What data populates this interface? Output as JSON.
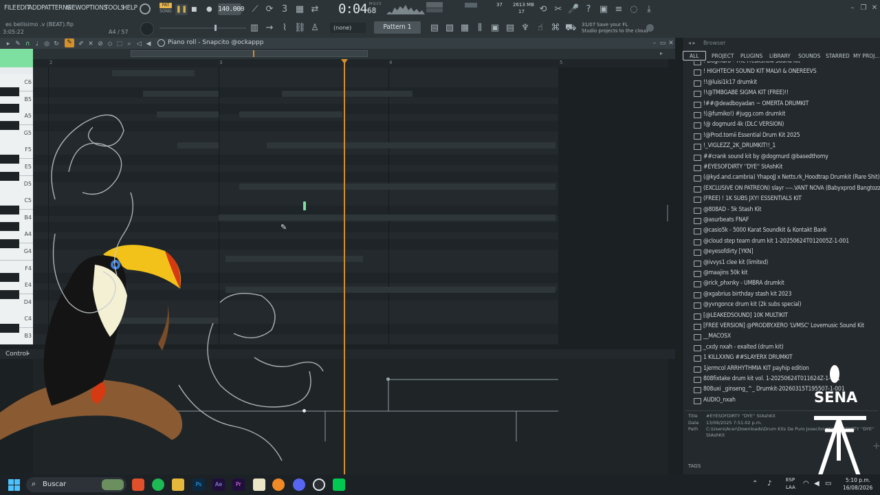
{
  "menu": [
    "FILE",
    "EDIT",
    "ADD",
    "PATTERNS",
    "VIEW",
    "OPTIONS",
    "TOOLS",
    "HELP"
  ],
  "transport": {
    "pat_label": "PAT",
    "song_label": "SONG",
    "tempo": "140.000",
    "time": "0:04",
    "time_small": "68",
    "time_unit": "M:S:CS",
    "cpu": "37",
    "mem": "2613 MB",
    "voices": "17"
  },
  "project": {
    "file": "es bellisimo .v (BEAT).flp",
    "position": "3:05:22",
    "note": "A4 / 57"
  },
  "toolbar": {
    "snap": "(none)",
    "pattern": "Pattern 1",
    "news_date": "31/07",
    "news_line1": "Save your FL",
    "news_line2": "Studio projects to the cloud"
  },
  "pianoroll": {
    "title": "Piano roll - Snapcito @ockappp",
    "bars": [
      "2",
      "3",
      "4",
      "5"
    ],
    "keys": [
      "C6",
      "B5",
      "A5",
      "G5",
      "F5",
      "E5",
      "D5",
      "C5",
      "B4",
      "A4",
      "G4",
      "F4",
      "E4",
      "D4",
      "C4",
      "B3"
    ],
    "control_label": "Control"
  },
  "browser": {
    "title": "Browser",
    "tabs": [
      "ALL",
      "PROJECT",
      "PLUGINS",
      "LIBRARY",
      "SOUNDS",
      "STARRED",
      "MY PROJ..."
    ],
    "items": [
      "! Dogmuro - The Freakshow Sound Kit",
      "! HIGHTECH SOUND KIT MALVI & ONEREEVS",
      "!!@luisi1k17 drumkit",
      "!!@TMBGABE SIGMA KIT (FREE)!!",
      "!##@deadboyadan ~ OMERTA DRUMKIT",
      "!(@fumiko!) #jugg.com drumkit",
      "!@ dogmurd 4k (DLC VERSION)",
      "!@Prod.tomii Essential Drum Kit 2025",
      "!_VIGLEZZ_2K_DRUMKIT!!_1",
      "##crank sound kit by @dogmurd @basedthomy",
      "#EYESOFDIRTY ''DYE'' StAshKit",
      "(@kyd.and.cambria) YhapoJJ x Netts.rk_Hoodtrap Drumkit (Rare Shit)",
      "(EXCLUSIVE ON PATREON) slayr ----.VANT NOVA (Babyxprod Bangtozzy)",
      "(FREE) ! 1K SUBS JXY! ESSENTIALS KIT",
      "@808AD - 5k Stash Kit",
      "@asurbeats FNAF",
      "@casio5k - 5000 Karat Soundkit & Kontakt Bank",
      "@cloud step team drum kit 1-20250624T012005Z-1-001",
      "@eyesofdirty [YKN]",
      "@ivvys1 clee kit (limited)",
      "@maajins 50k kit",
      "@rick_phxnky - UMBRA drumkit",
      "@xgabrius birthday stash kit 2023",
      "@yvngonce drum kit (2k subs special)",
      "[@LEAKEDSOUND] 10K MULTIKIT",
      "[FREE VERSION] @PRODBY.XERO 'LVMSC' Lovemusic Sound Kit",
      "__MACOSX",
      "_cxdy nxah - exalted (drum kit)",
      "1 KILLXXNG ##SLAYERX DRUMKIT",
      "1jermcol ARRHYTHMIA KIT payhip edition",
      "808fixtake drum kit vol. 1-20250624T011624Z-1-001",
      "808uxi _ginseng_^_ Drumkit-20260315T195507-1-001",
      "AUDIO_nxah"
    ],
    "info": {
      "title_label": "Title",
      "title": "#EYESOFDIRTY ''DYE'' StAshKit",
      "date_label": "Date",
      "date": "13/09/2025 7:51:02 p.m.",
      "path_label": "Path",
      "path": "C:\\Users\\Acer\\Downloads\\Drum Kits De Puro Josecito\\#EYESOFDIRTY ''DYE'' StAshKit",
      "tags": "TAGS"
    }
  },
  "watermark": "SENA",
  "taskbar": {
    "search": "Buscar",
    "lang1": "ESP",
    "lang2": "LAA",
    "time": "5:10 p.m.",
    "date": "16/08/2026"
  },
  "colors": {
    "accent": "#d4902a",
    "note": "#7ee0a0",
    "bg": "#23292c"
  }
}
